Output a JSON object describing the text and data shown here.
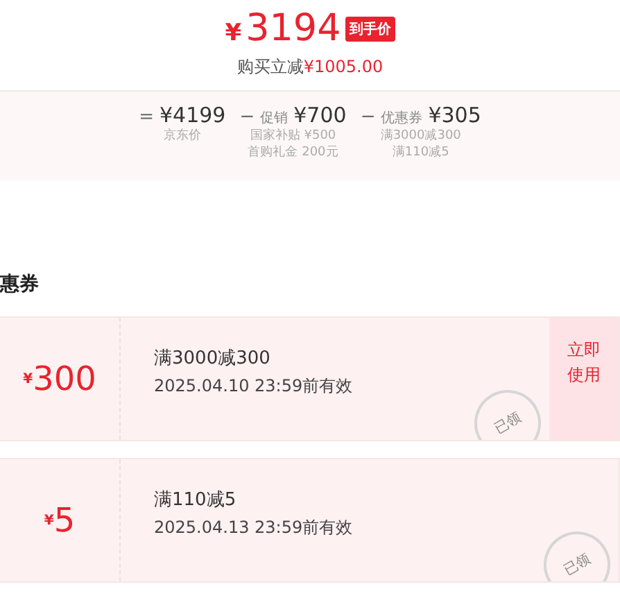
{
  "price": {
    "currency": "¥",
    "amount": "3194",
    "badge": "到手价",
    "saving_label": "购买立减",
    "saving_amount": "¥1005.00"
  },
  "breakdown": [
    {
      "op": "=",
      "amount": "¥4199",
      "notes": [
        "京东价"
      ]
    },
    {
      "op": "−",
      "label": "促销",
      "amount": "¥700",
      "notes": [
        "国家补贴 ¥500",
        "首购礼金 200元"
      ]
    },
    {
      "op": "−",
      "label": "优惠券",
      "amount": "¥305",
      "notes": [
        "满3000减300",
        "满110减5"
      ]
    }
  ],
  "coupons_heading": "惠券",
  "coupons": [
    {
      "currency": "¥",
      "value": "300",
      "title": "满3000减300",
      "expiry": "2025.04.10 23:59前有效",
      "stamp": "已领",
      "action": "立即使用"
    },
    {
      "currency": "¥",
      "value": "5",
      "title": "满110减5",
      "expiry": "2025.04.13 23:59前有效",
      "stamp": "已领"
    }
  ]
}
